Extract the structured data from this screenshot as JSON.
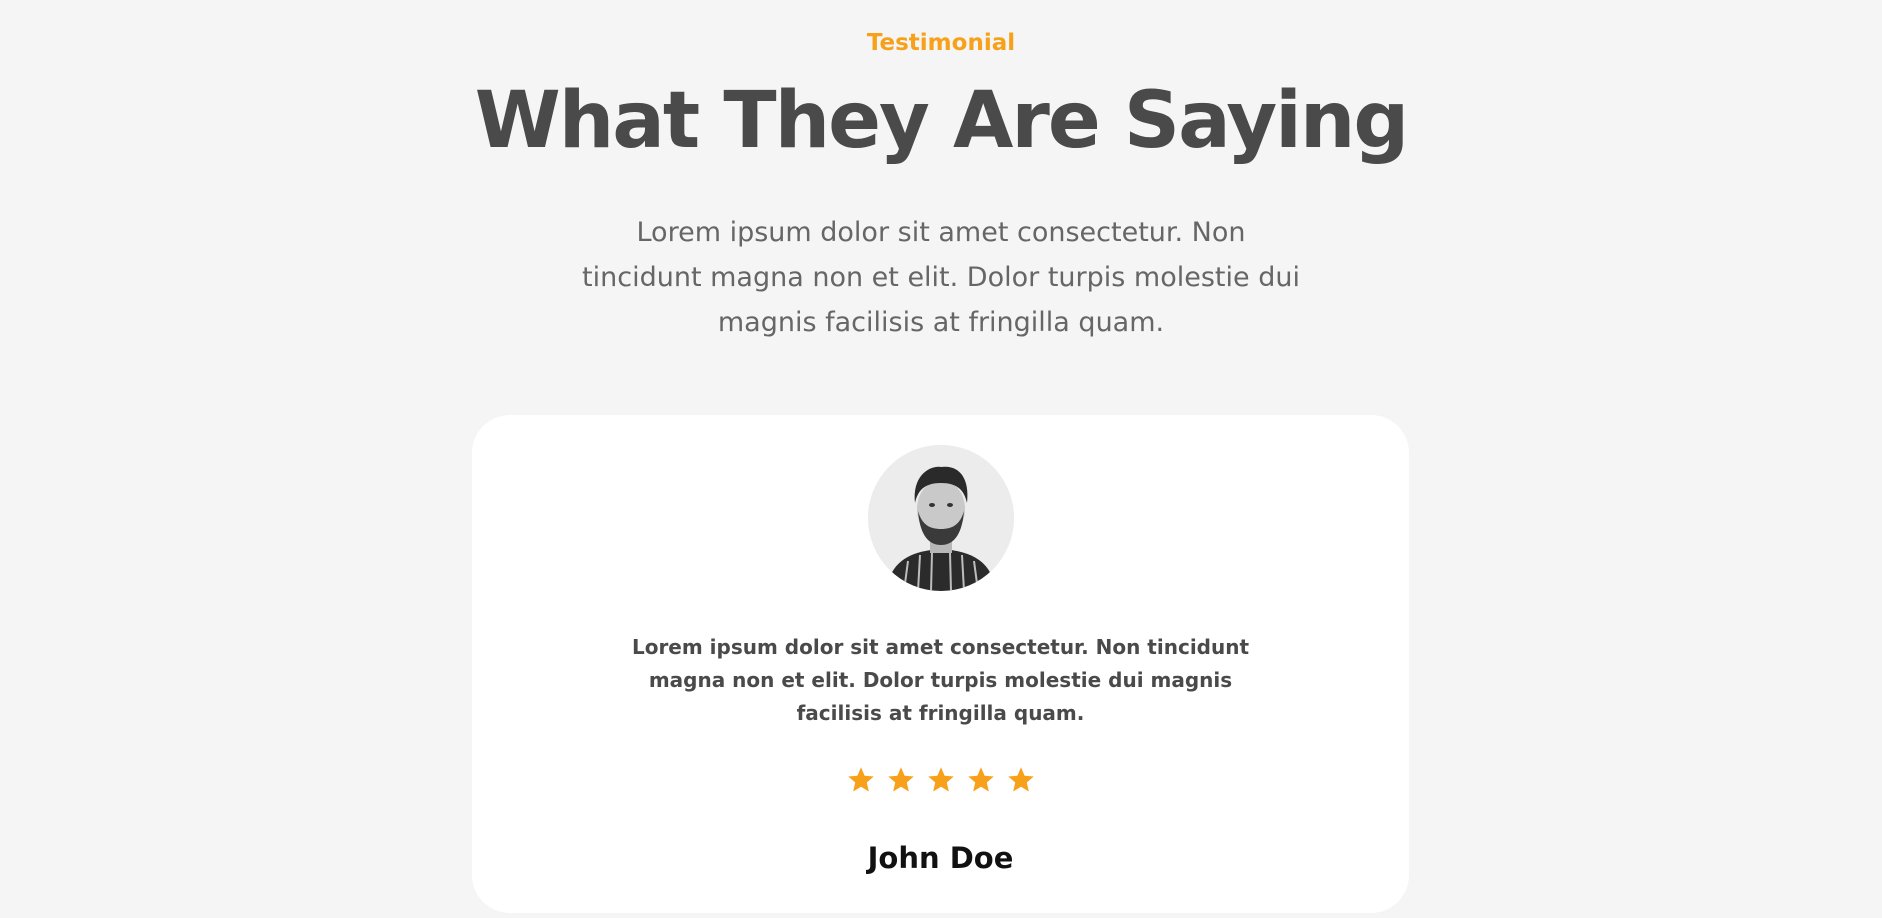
{
  "section": {
    "eyebrow": "Testimonial",
    "title": "What They Are Saying",
    "subtitle": "Lorem ipsum dolor sit amet consectetur. Non tincidunt magna non et elit. Dolor turpis molestie dui magnis facilisis at fringilla quam."
  },
  "testimonial": {
    "avatar_icon": "person-photo",
    "quote": "Lorem ipsum dolor sit amet consectetur. Non tincidunt magna non et elit. Dolor turpis molestie dui magnis facilisis at fringilla quam.",
    "rating": 5,
    "rating_max": 5,
    "star_icon": "star-icon",
    "author": "John Doe"
  },
  "colors": {
    "accent": "#f7a11a",
    "background": "#f5f5f5",
    "card": "#ffffff",
    "heading": "#4a4a4a",
    "body_text": "#666666"
  }
}
